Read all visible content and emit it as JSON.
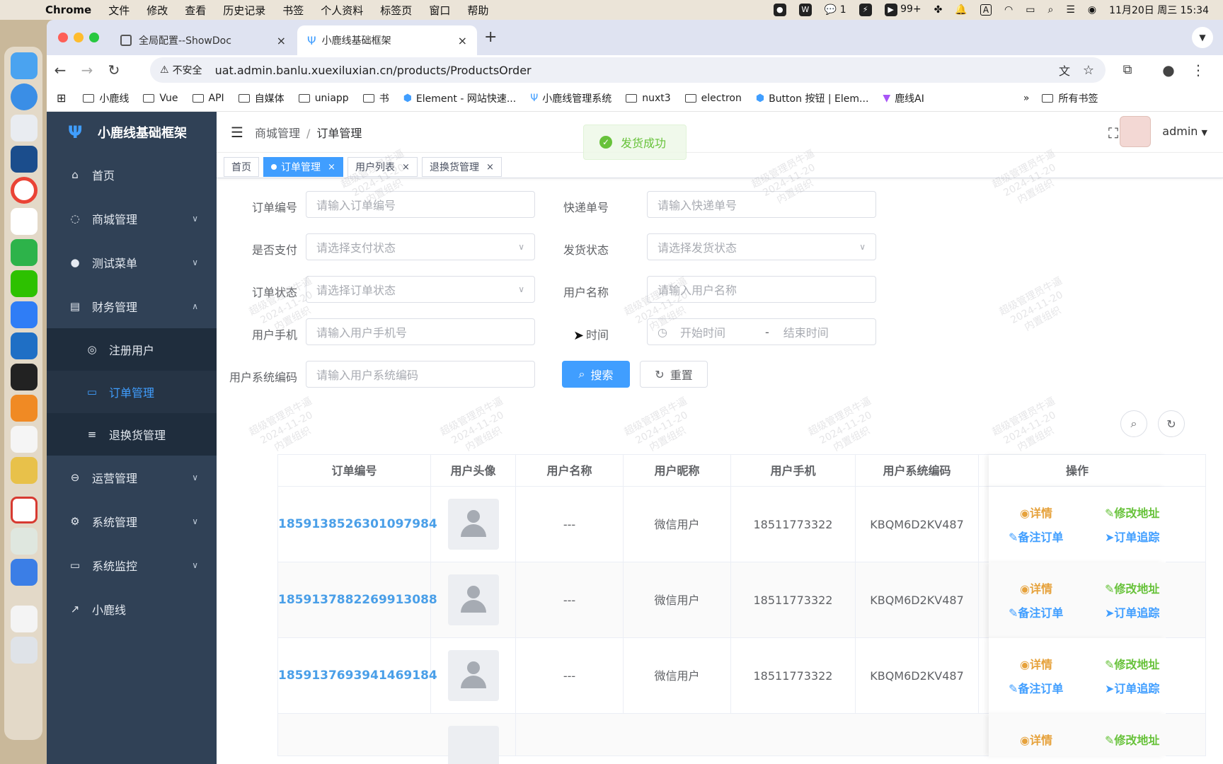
{
  "menubar": {
    "app": "Chrome",
    "items": [
      "文件",
      "修改",
      "查看",
      "历史记录",
      "书签",
      "个人资料",
      "标签页",
      "窗口",
      "帮助"
    ],
    "wechat_count": "1",
    "badge_count": "99+",
    "input_method": "A",
    "datetime": "11月20日 周三  15:34"
  },
  "browser": {
    "tabs": [
      {
        "title": "全局配置--ShowDoc"
      },
      {
        "title": "小鹿线基础框架"
      }
    ],
    "security_label": "不安全",
    "url": "uat.admin.banlu.xuexiluxian.cn/products/ProductsOrder",
    "bookmarks": [
      "小鹿线",
      "Vue",
      "API",
      "自媒体",
      "uniapp",
      "书",
      "Element - 网站快速...",
      "小鹿线管理系统",
      "nuxt3",
      "electron",
      "Button 按钮 | Elem...",
      "鹿线AI"
    ],
    "all_bookmarks": "所有书签"
  },
  "sidebar": {
    "brand": "小鹿线基础框架",
    "items": [
      {
        "label": "首页"
      },
      {
        "label": "商城管理"
      },
      {
        "label": "测试菜单"
      },
      {
        "label": "财务管理"
      },
      {
        "label": "注册用户"
      },
      {
        "label": "订单管理"
      },
      {
        "label": "退换货管理"
      },
      {
        "label": "运营管理"
      },
      {
        "label": "系统管理"
      },
      {
        "label": "系统监控"
      },
      {
        "label": "小鹿线"
      }
    ]
  },
  "navbar": {
    "crumb_parent": "商城管理",
    "crumb_separator": "/",
    "crumb_current": "订单管理",
    "toast": "发货成功",
    "user": "admin"
  },
  "tags": [
    {
      "label": "首页"
    },
    {
      "label": "订单管理"
    },
    {
      "label": "用户列表"
    },
    {
      "label": "退换货管理"
    }
  ],
  "form": {
    "order_no_label": "订单编号",
    "order_no_placeholder": "请输入订单编号",
    "express_label": "快递单号",
    "express_placeholder": "请输入快递单号",
    "paid_label": "是否支付",
    "paid_placeholder": "请选择支付状态",
    "ship_label": "发货状态",
    "ship_placeholder": "请选择发货状态",
    "order_status_label": "订单状态",
    "order_status_placeholder": "请选择订单状态",
    "username_label": "用户名称",
    "username_placeholder": "请输入用户名称",
    "phone_label": "用户手机",
    "phone_placeholder": "请输入用户手机号",
    "time_label": "时间",
    "start_placeholder": "开始时间",
    "time_sep": "-",
    "end_placeholder": "结束时间",
    "syscode_label": "用户系统编码",
    "syscode_placeholder": "请输入用户系统编码",
    "search_btn": "搜索",
    "reset_btn": "重置"
  },
  "table": {
    "headers": [
      "订单编号",
      "用户头像",
      "用户名称",
      "用户昵称",
      "用户手机",
      "用户系统编码",
      "操作"
    ],
    "rows": [
      {
        "order_no": "1859138526301097984",
        "name": "---",
        "nickname": "微信用户",
        "phone": "18511773322",
        "code": "KBQM6D2KV487"
      },
      {
        "order_no": "1859137882269913088",
        "name": "---",
        "nickname": "微信用户",
        "phone": "18511773322",
        "code": "KBQM6D2KV487"
      },
      {
        "order_no": "1859137693941469184",
        "name": "---",
        "nickname": "微信用户",
        "phone": "18511773322",
        "code": "KBQM6D2KV487"
      }
    ],
    "actions": {
      "detail": "详情",
      "edit_address": "修改地址",
      "remark": "备注订单",
      "track": "订单追踪"
    }
  },
  "watermark": [
    "超级管理员牛逼",
    "2024-11-20",
    "内置组织"
  ]
}
